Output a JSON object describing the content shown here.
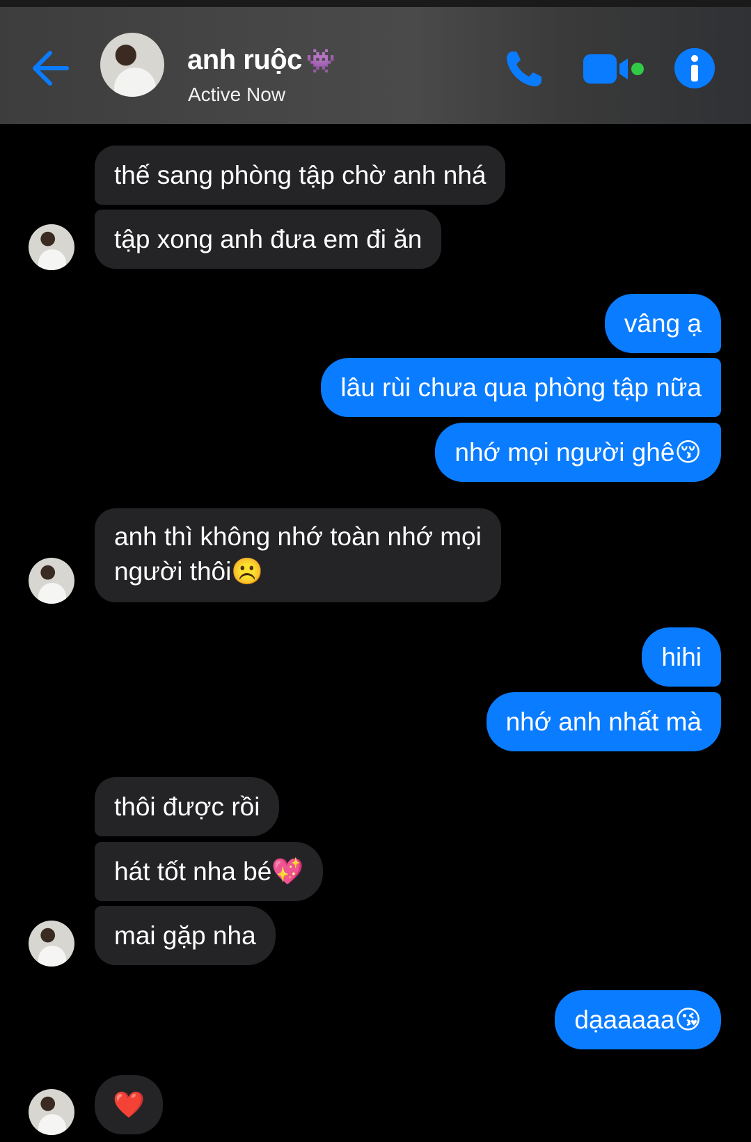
{
  "header": {
    "contact_name": "anh ruộc",
    "name_emoji": "👾",
    "status": "Active Now",
    "icons": [
      "back-arrow-icon",
      "phone-icon",
      "video-camera-icon",
      "info-icon"
    ],
    "accent_color": "#0a7cff",
    "online_dot_color": "#31cc46"
  },
  "messages": [
    {
      "side": "in",
      "text": "thế sang phòng tập chờ anh nhá"
    },
    {
      "side": "in",
      "text": "tập xong anh đưa em đi ăn"
    },
    {
      "side": "out",
      "text": "vâng ạ"
    },
    {
      "side": "out",
      "text": "lâu rùi chưa qua phòng tập nữa"
    },
    {
      "side": "out",
      "text": "nhớ mọi người ghê😚"
    },
    {
      "side": "in",
      "text": "anh thì không nhớ toàn nhớ mọi"
    },
    {
      "side": "in",
      "text": "người thôi☹️"
    },
    {
      "side": "out",
      "text": "hihi"
    },
    {
      "side": "out",
      "text": "nhớ anh nhất mà"
    },
    {
      "side": "in",
      "text": "thôi được rồi"
    },
    {
      "side": "in",
      "text": "hát tốt nha bé💖"
    },
    {
      "side": "in",
      "text": "mai gặp nha"
    },
    {
      "side": "out",
      "text": "dạaaaaa😘"
    },
    {
      "side": "in",
      "text": "❤️"
    }
  ]
}
